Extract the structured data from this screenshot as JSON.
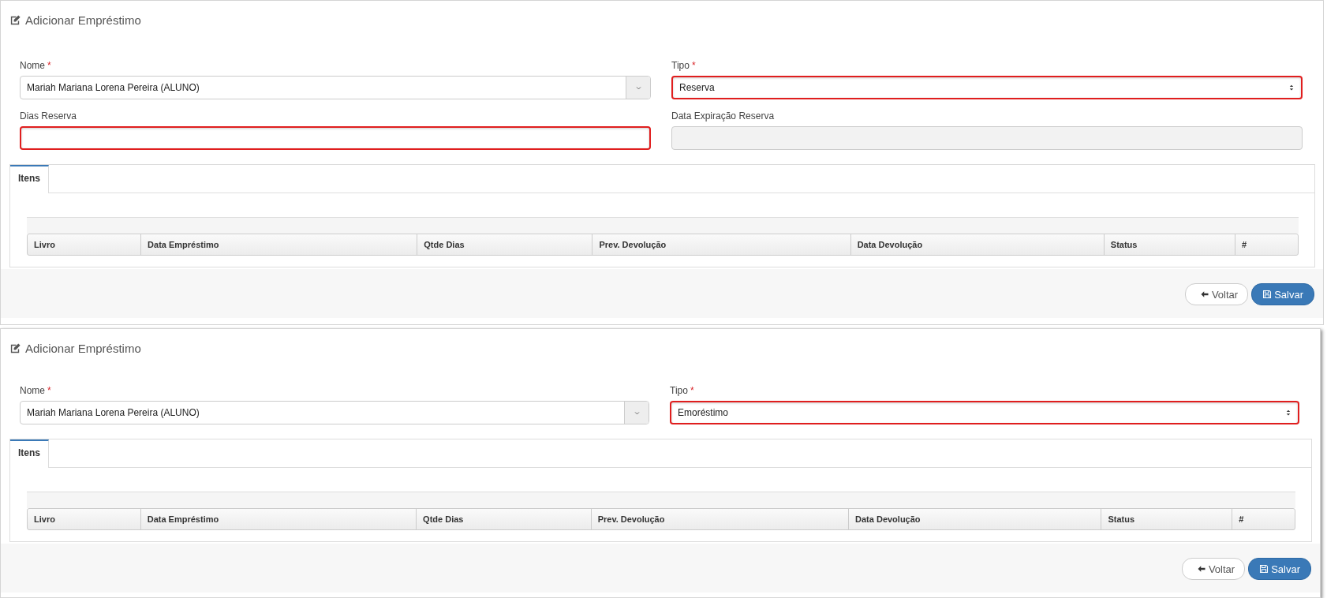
{
  "panels": [
    {
      "title": "Adicionar Empréstimo",
      "fields": [
        {
          "kind": "combo",
          "label": "Nome",
          "required_mark": "*",
          "value": "Mariah Mariana Lorena Pereira (ALUNO)",
          "highlighted": false,
          "disabled": false
        },
        {
          "kind": "select",
          "label": "Tipo",
          "required_mark": "*",
          "value": "Reserva",
          "highlighted": true,
          "disabled": false
        },
        {
          "kind": "text",
          "label": "Dias Reserva",
          "highlighted": true,
          "disabled": false
        },
        {
          "kind": "text",
          "label": "Data Expiração Reserva",
          "highlighted": false,
          "disabled": true
        }
      ],
      "tabs": [
        {
          "label": "Itens",
          "selected": true
        }
      ],
      "columns": [
        "Livro",
        "Data Empréstimo",
        "Qtde Dias",
        "Prev. Devolução",
        "Data Devolução",
        "Status",
        "#"
      ],
      "buttons": [
        {
          "kind": "back",
          "label": "Voltar"
        },
        {
          "kind": "save",
          "label": "Salvar"
        }
      ]
    },
    {
      "title": "Adicionar Empréstimo",
      "fields": [
        {
          "kind": "combo",
          "label": "Nome",
          "required_mark": "*",
          "value": "Mariah Mariana Lorena Pereira (ALUNO)",
          "highlighted": false,
          "disabled": false
        },
        {
          "kind": "select",
          "label": "Tipo",
          "required_mark": "*",
          "value": "Emoréstimo",
          "highlighted": true,
          "disabled": false
        }
      ],
      "tabs": [
        {
          "label": "Itens",
          "selected": true
        }
      ],
      "columns": [
        "Livro",
        "Data Empréstimo",
        "Qtde Dias",
        "Prev. Devolução",
        "Data Devolução",
        "Status",
        "#"
      ],
      "buttons": [
        {
          "kind": "back",
          "label": "Voltar"
        },
        {
          "kind": "save",
          "label": "Salvar"
        }
      ]
    }
  ]
}
